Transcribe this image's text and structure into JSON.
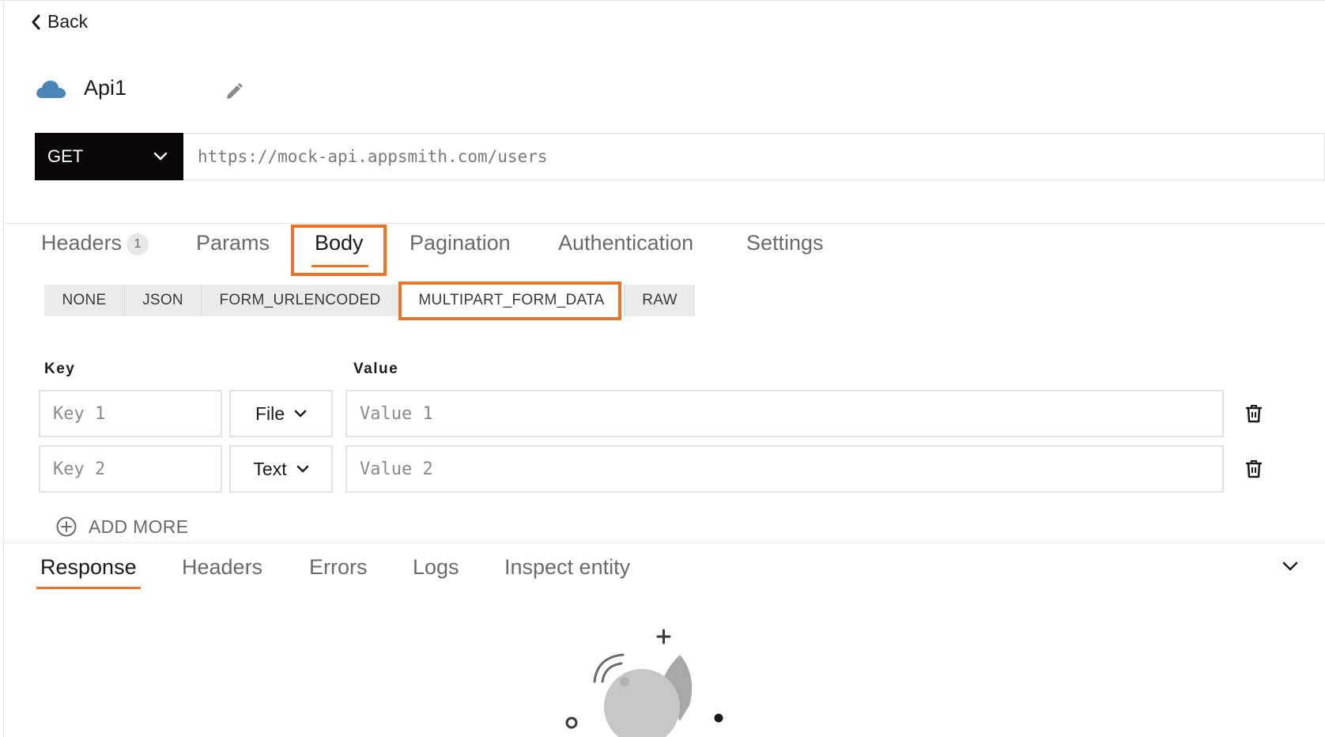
{
  "nav": {
    "back_label": "Back"
  },
  "api": {
    "name": "Api1"
  },
  "request": {
    "method": "GET",
    "url_placeholder": "https://mock-api.appsmith.com/users"
  },
  "tabs": {
    "headers": {
      "label": "Headers",
      "count": "1"
    },
    "params": "Params",
    "body": "Body",
    "pagination": "Pagination",
    "authentication": "Authentication",
    "settings": "Settings",
    "active": "Body"
  },
  "body_types": [
    "NONE",
    "JSON",
    "FORM_URLENCODED",
    "MULTIPART_FORM_DATA",
    "RAW"
  ],
  "selected_body_type": "MULTIPART_FORM_DATA",
  "form": {
    "key_header": "Key",
    "value_header": "Value",
    "rows": [
      {
        "key_placeholder": "Key 1",
        "type": "File",
        "value_placeholder": "Value 1"
      },
      {
        "key_placeholder": "Key 2",
        "type": "Text",
        "value_placeholder": "Value 2"
      }
    ],
    "add_more_label": "ADD MORE"
  },
  "response_tabs": {
    "items": [
      "Response",
      "Headers",
      "Errors",
      "Logs",
      "Inspect entity"
    ],
    "active": "Response"
  },
  "colors": {
    "accent": "#e8752b",
    "method_bg": "#090707",
    "cloud": "#4a87b8"
  }
}
